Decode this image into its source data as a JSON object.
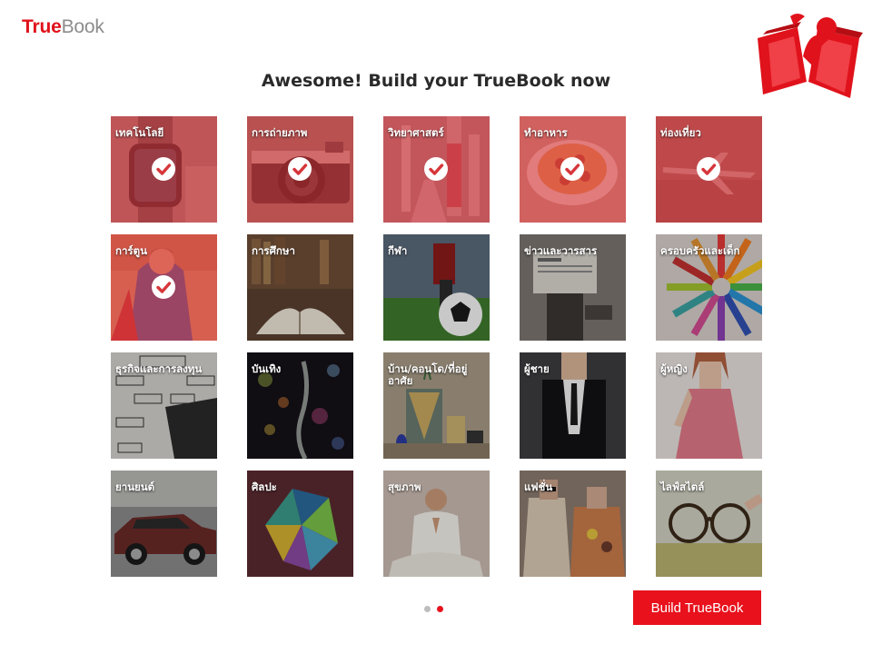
{
  "brand": {
    "part1": "True",
    "part2": "Book"
  },
  "headline": "Awesome! Build your TrueBook now",
  "colors": {
    "accent": "#e8111c",
    "selected_overlay": "#d6363a",
    "dot_inactive": "#bdbdbd",
    "dot_active": "#e8111c"
  },
  "tiles": [
    {
      "label": "เทคโนโลยี",
      "selected": true,
      "image": "smartwatch"
    },
    {
      "label": "การถ่ายภาพ",
      "selected": true,
      "image": "camera"
    },
    {
      "label": "วิทยาศาสตร์",
      "selected": true,
      "image": "lab-glassware"
    },
    {
      "label": "ทำอาหาร",
      "selected": true,
      "image": "pie"
    },
    {
      "label": "ท่องเที่ยว",
      "selected": true,
      "image": "airplane"
    },
    {
      "label": "การ์ตูน",
      "selected": true,
      "image": "comic-hero"
    },
    {
      "label": "การศึกษา",
      "selected": false,
      "image": "books"
    },
    {
      "label": "กีฬา",
      "selected": false,
      "image": "soccer-ball"
    },
    {
      "label": "ข่าวและวารสาร",
      "selected": false,
      "image": "newspaper-reader"
    },
    {
      "label": "ครอบครัวและเด็ก",
      "selected": false,
      "image": "color-pencils"
    },
    {
      "label": "ธุรกิจและการลงทุน",
      "selected": false,
      "image": "business-plan"
    },
    {
      "label": "บันเทิง",
      "selected": false,
      "image": "bokeh-lights"
    },
    {
      "label": "บ้าน/คอนโด/ที่อยู่อาศัย",
      "selected": false,
      "image": "home-decor"
    },
    {
      "label": "ผู้ชาย",
      "selected": false,
      "image": "man-suit"
    },
    {
      "label": "ผู้หญิง",
      "selected": false,
      "image": "woman-dress"
    },
    {
      "label": "ยานยนต์",
      "selected": false,
      "image": "classic-car"
    },
    {
      "label": "ศิลปะ",
      "selected": false,
      "image": "origami"
    },
    {
      "label": "สุขภาพ",
      "selected": false,
      "image": "meditation"
    },
    {
      "label": "แฟชั่น",
      "selected": false,
      "image": "fashion-models"
    },
    {
      "label": "ไลฟ์สไตล์",
      "selected": false,
      "image": "eyeglasses"
    }
  ],
  "pagination": {
    "pages": 2,
    "current": 2
  },
  "build_button": "Build TrueBook"
}
